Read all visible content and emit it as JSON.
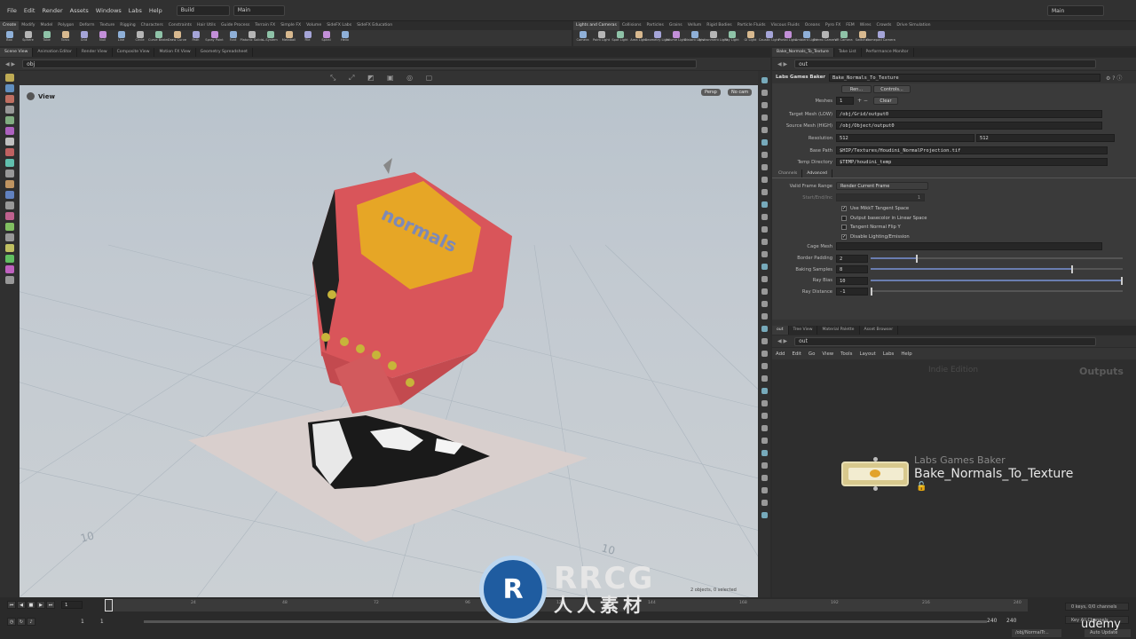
{
  "menubar": {
    "items": [
      "File",
      "Edit",
      "Render",
      "Assets",
      "Windows",
      "Labs",
      "Help"
    ],
    "desktop": "Build",
    "view": "Main",
    "right_desktop": "Main"
  },
  "shelf_tabs_left": [
    "Create",
    "Modify",
    "Model",
    "Polygon",
    "Deform",
    "Texture",
    "Rigging",
    "Characters",
    "Constraints",
    "Hair Utils",
    "Guide Process",
    "Terrain FX",
    "Simple FX",
    "Volume",
    "SideFX Labs",
    "SideFX Education"
  ],
  "shelf_tabs_right": [
    "Lights and Cameras",
    "Collisions",
    "Particles",
    "Grains",
    "Vellum",
    "Rigid Bodies",
    "Particle Fluids",
    "Viscous Fluids",
    "Oceans",
    "Pyro FX",
    "FEM",
    "Wires",
    "Crowds",
    "Drive Simulation"
  ],
  "shelf_tools_left": [
    "Box",
    "Sphere",
    "Tube",
    "Torus",
    "Grid",
    "Null",
    "Line",
    "Circle",
    "Curve Bezier",
    "Draw Curve",
    "Path",
    "Spray Paint",
    "Font",
    "Platonic Solids",
    "L-System",
    "Metaball",
    "File",
    "Spiral",
    "Helix"
  ],
  "shelf_tools_right": [
    "Camera",
    "Point Light",
    "Spot Light",
    "Area Light",
    "Geometry Light",
    "Volume Light",
    "Distant Light",
    "Environment Light",
    "Sky Light",
    "GI Light",
    "Caustic Light",
    "Portal Light",
    "Ambient Light",
    "Stereo Camera",
    "VR Camera",
    "Switcher",
    "Gamepad Camera"
  ],
  "left_pane_tabs": [
    "Scene View",
    "Animation Editor",
    "Render View",
    "Composite View",
    "Motion FX View",
    "Geometry Spreadsheet"
  ],
  "left_path": "obj",
  "viewport": {
    "label": "View",
    "persp": "Persp",
    "cam": "No cam",
    "status": "2 objects, 0 selected",
    "logo_text": "normals",
    "grid_labels": [
      "10",
      "10"
    ]
  },
  "right_pane_tabs": [
    "Bake_Normals_To_Texture",
    "Take List",
    "Performance Monitor"
  ],
  "right_path": "out",
  "params": {
    "node_type": "Labs Games Baker",
    "node_name": "Bake_Normals_To_Texture",
    "render_btn": "Ren...",
    "controls_btn": "Controls...",
    "meshes_label": "Meshes",
    "meshes_value": "1",
    "clear_btn": "Clear",
    "target_label": "Target Mesh (LOW)",
    "target_value": "/obj/Grid/output0",
    "source_label": "Source Mesh (HIGH)",
    "source_value": "/obj/Object/output0",
    "res_label": "Resolution",
    "res_x": "512",
    "res_y": "512",
    "base_label": "Base Path",
    "base_value": "$HIP/Textures/Houdini_NormalProjection.tif",
    "temp_label": "Temp Directory",
    "temp_value": "$TEMP/houdini_temp",
    "tabs": [
      "Channels",
      "Advanced"
    ],
    "vfr_label": "Valid Frame Range",
    "vfr_value": "Render Current Frame",
    "sei_label": "Start/End/Inc",
    "sei_value": "1",
    "checks": [
      {
        "label": "Use MikkT Tangent Space",
        "on": true
      },
      {
        "label": "Output basecolor in Linear Space",
        "on": false
      },
      {
        "label": "Tangent Normal Flip Y",
        "on": false
      },
      {
        "label": "Disable Lighting/Emission",
        "on": true
      }
    ],
    "cage_label": "Cage Mesh",
    "sliders": [
      {
        "label": "Border Padding",
        "value": "2",
        "frac": 0.18
      },
      {
        "label": "Baking Samples",
        "value": "8",
        "frac": 0.8
      },
      {
        "label": "Ray Bias",
        "value": "10",
        "frac": 1.0
      },
      {
        "label": "Ray Distance",
        "value": "-1",
        "frac": 0.0
      }
    ]
  },
  "net_tabs": [
    "out",
    "Tree View",
    "Material Palette",
    "Asset Browser"
  ],
  "net_path": "out",
  "net_menu": [
    "Add",
    "Edit",
    "Go",
    "View",
    "Tools",
    "Layout",
    "Labs",
    "Help"
  ],
  "net": {
    "watermark": "Indie Edition",
    "context": "Outputs",
    "node_type": "Labs Games Baker",
    "node_name": "Bake_Normals_To_Texture"
  },
  "timeline": {
    "frame": "1",
    "start": "1",
    "start2": "1",
    "end": "240",
    "end2": "240",
    "ticks": [
      "24",
      "48",
      "72",
      "96",
      "120",
      "144",
      "168",
      "192",
      "216",
      "240"
    ],
    "keys": "0 keys, 0/0 channels",
    "keyall": "Key All Channels",
    "auto": "Auto Update",
    "path": "/obj/NormalTr..."
  },
  "watermark": {
    "brand": "RRCG",
    "sub": "人人素材",
    "udemy": "udemy"
  }
}
